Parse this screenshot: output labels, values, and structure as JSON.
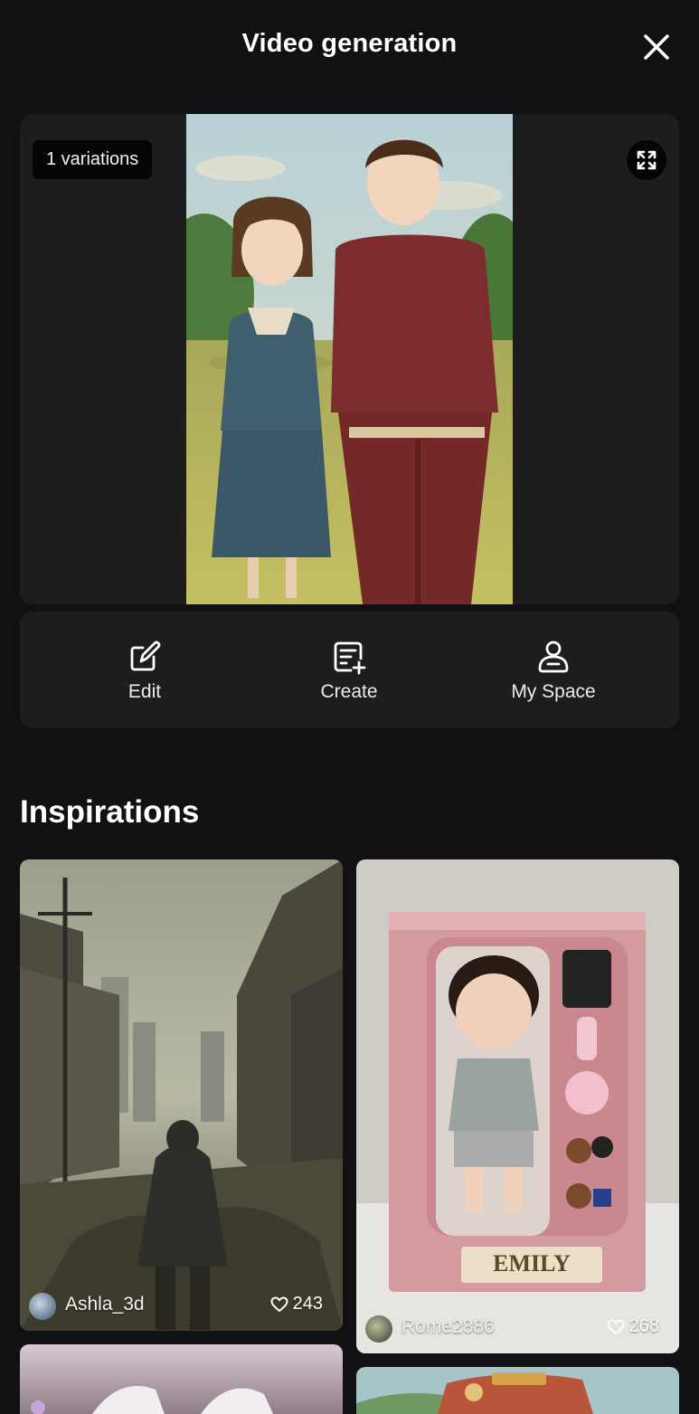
{
  "header": {
    "title": "Video generation",
    "close_icon": "close-icon"
  },
  "preview": {
    "variations_label": "1 variations",
    "expand_icon": "expand-icon"
  },
  "actions": [
    {
      "label": "Edit",
      "icon": "edit-icon"
    },
    {
      "label": "Create",
      "icon": "create-icon"
    },
    {
      "label": "My Space",
      "icon": "my-space-icon"
    }
  ],
  "inspirations": {
    "title": "Inspirations",
    "cards": [
      {
        "author": "Ashla_3d",
        "likes": "243"
      },
      {
        "author": "Rome2886",
        "likes": "268"
      }
    ]
  },
  "colors": {
    "background": "#111113",
    "panel": "#1d1d20",
    "badge": "#050505",
    "text": "#ffffff"
  }
}
